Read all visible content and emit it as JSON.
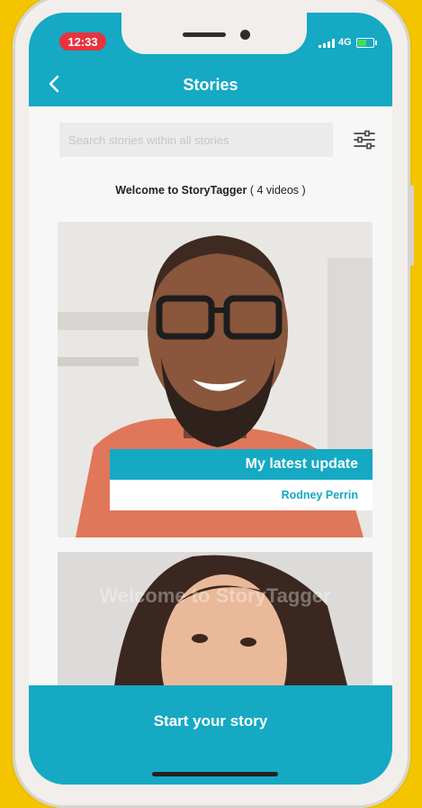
{
  "status": {
    "time": "12:33",
    "network": "4G"
  },
  "nav": {
    "title": "Stories"
  },
  "search": {
    "placeholder": "Search stories within all stories"
  },
  "welcome": {
    "app_name": "Welcome to StoryTagger",
    "count": "( 4 videos )"
  },
  "stories": [
    {
      "title": "My latest update",
      "author": "Rodney Perrin"
    },
    {
      "watermark": "Welcome to StoryTagger"
    }
  ],
  "cta": {
    "label": "Start your story"
  },
  "colors": {
    "accent": "#15a9c4",
    "background": "#f5c400",
    "time_pill": "#e8333d"
  }
}
